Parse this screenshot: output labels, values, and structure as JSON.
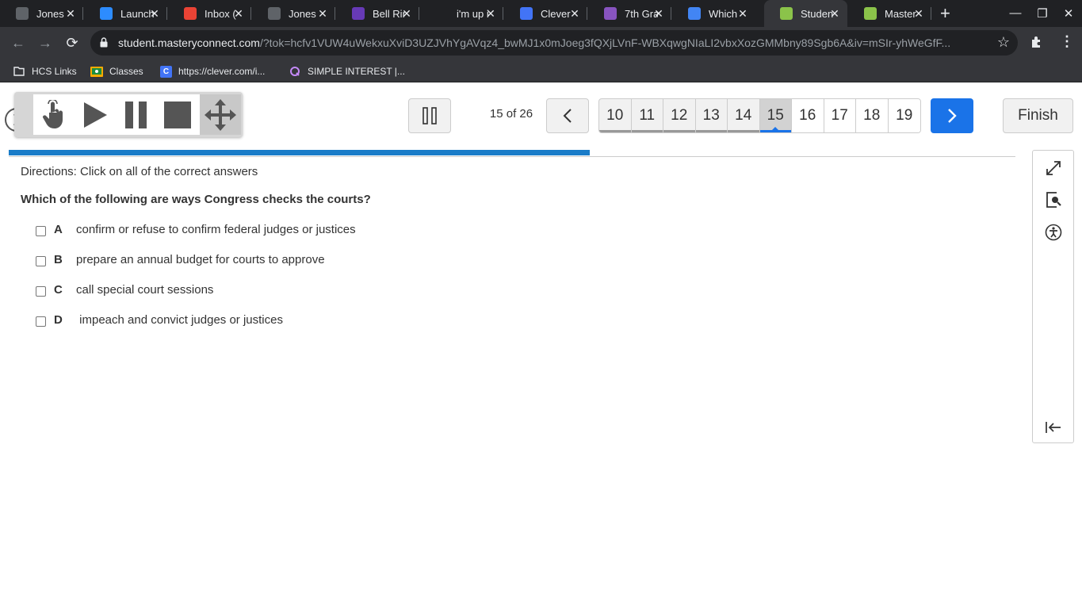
{
  "browser": {
    "tabs": [
      {
        "label": "Jones",
        "icon": "contact-icon",
        "color": "#5f6368"
      },
      {
        "label": "Launch",
        "icon": "zoom-icon",
        "color": "#2d8cff"
      },
      {
        "label": "Inbox (",
        "icon": "gmail-icon",
        "color": "#ea4335"
      },
      {
        "label": "Jones",
        "icon": "contact-icon",
        "color": "#5f6368"
      },
      {
        "label": "Bell Rin",
        "icon": "forms-icon",
        "color": "#673ab7"
      },
      {
        "label": "i'm up i",
        "icon": "brainly-icon",
        "color": "#202124"
      },
      {
        "label": "Clever",
        "icon": "clever-icon",
        "color": "#4274f6"
      },
      {
        "label": "7th Gra",
        "icon": "quizizz-icon",
        "color": "#8854c0"
      },
      {
        "label": "Which",
        "icon": "google-icon",
        "color": "#4285f4"
      },
      {
        "label": "Studen",
        "icon": "masteryconnect-icon",
        "color": "#8bc34a"
      },
      {
        "label": "Master",
        "icon": "masteryconnect-icon",
        "color": "#8bc34a"
      }
    ],
    "active_tab_index": 9,
    "url_host": "student.masteryconnect.com",
    "url_rest": "/?tok=hcfv1VUW4uWekxuXviD3UZJVhYgAVqz4_bwMJ1x0mJoeg3fQXjLVnF-WBXqwgNIaLI2vbxXozGMMbny89Sgb6A&iv=mSIr-yhWeGfF...",
    "bookmarks": [
      {
        "label": "HCS Links",
        "icon": "folder-icon"
      },
      {
        "label": "Classes",
        "icon": "classroom-icon"
      },
      {
        "label": "https://clever.com/i...",
        "icon": "clever-icon"
      },
      {
        "label": "SIMPLE INTEREST |...",
        "icon": "quizizz-icon"
      }
    ]
  },
  "assessment": {
    "counter": "15 of 26",
    "question_numbers": [
      "10",
      "11",
      "12",
      "13",
      "14",
      "15",
      "16",
      "17",
      "18",
      "19"
    ],
    "current_question": "15",
    "finish_label": "Finish",
    "progress_fraction": 0.577,
    "directions": "Directions: Click on all of the correct answers",
    "question": "Which of the following are ways Congress checks the courts?",
    "choices": [
      {
        "letter": "A",
        "text": "confirm or refuse to confirm federal judges or justices",
        "checked": false
      },
      {
        "letter": "B",
        "text": "prepare an annual budget for courts to approve",
        "checked": false
      },
      {
        "letter": "C",
        "text": "call special court sessions",
        "checked": false
      },
      {
        "letter": "D",
        "text": " impeach and convict judges or justices",
        "checked": false
      }
    ]
  },
  "colors": {
    "accent": "#1a73e8",
    "progress": "#1a7cc8"
  }
}
